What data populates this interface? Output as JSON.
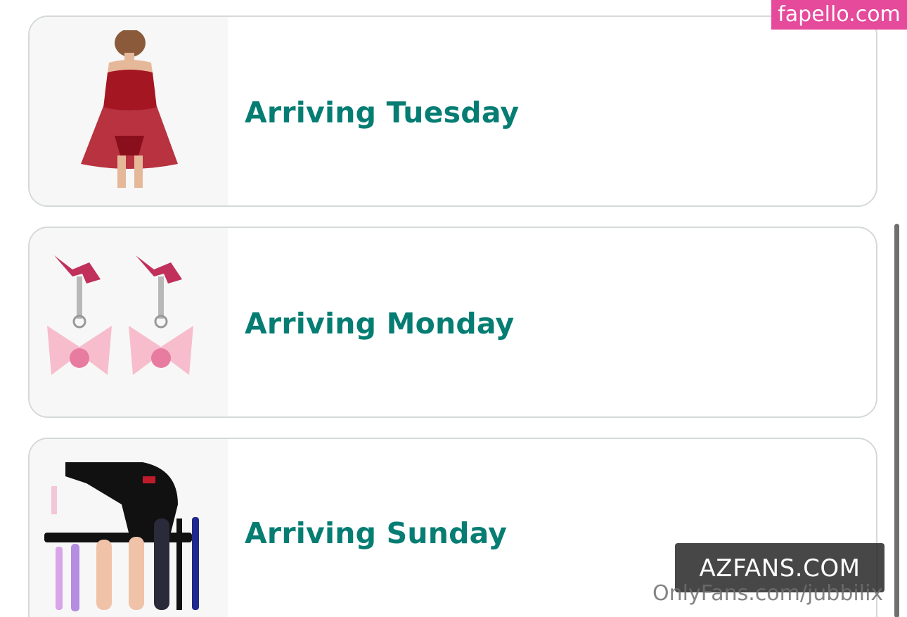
{
  "orders": [
    {
      "status": "Arriving Tuesday",
      "product_image": "red-lace-babydoll-lingerie"
    },
    {
      "status": "Arriving Monday",
      "product_image": "pink-bow-clamp-pair"
    },
    {
      "status": "Arriving Sunday",
      "product_image": "black-machine-with-attachments"
    }
  ],
  "watermarks": {
    "top_right": "fapello.com",
    "overlay": "AZFANS.COM",
    "credit": "OnlyFans.com/jubbilix"
  },
  "colors": {
    "status_text": "#067d73",
    "card_border": "#d5d9d9",
    "thumb_bg": "#f7f7f7",
    "watermark_pink": "#e54a9b"
  }
}
